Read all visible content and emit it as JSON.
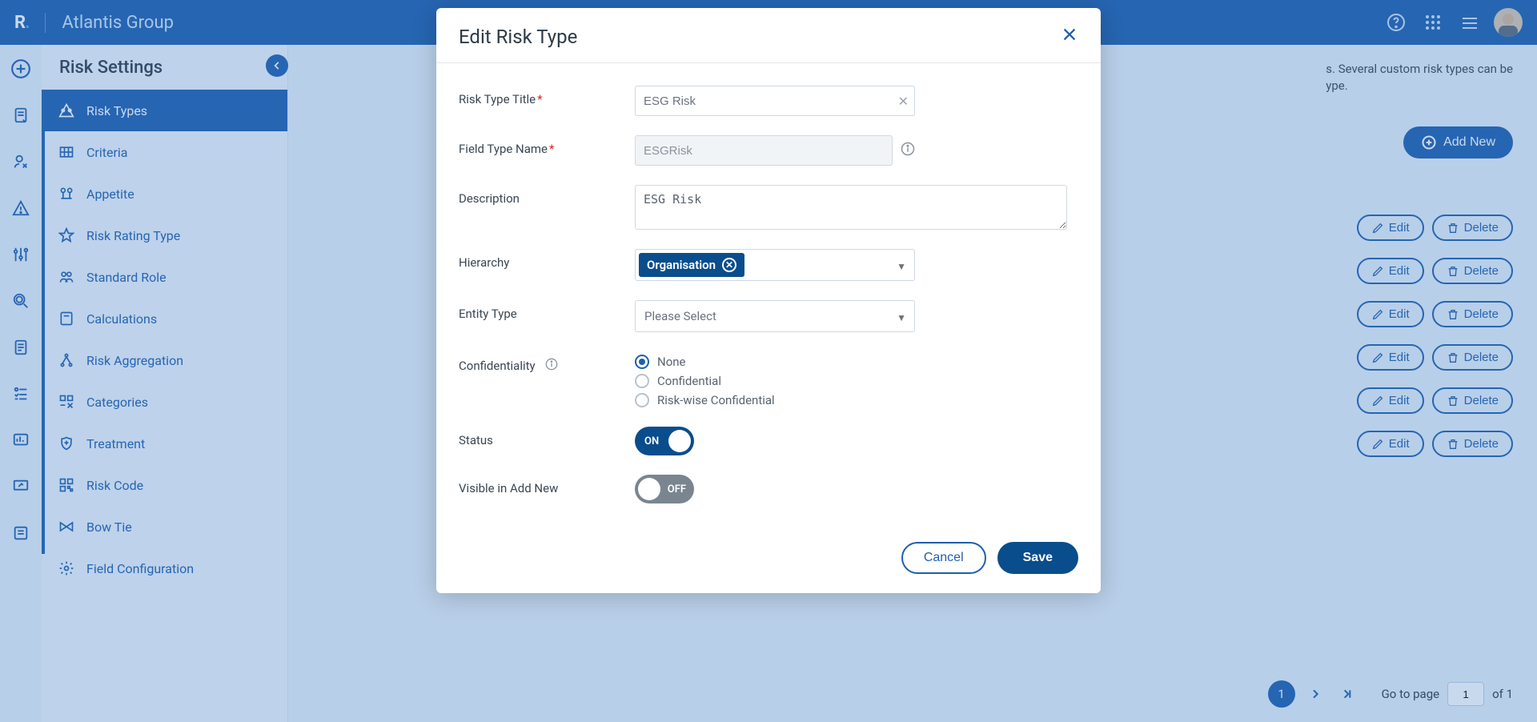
{
  "header": {
    "logo": "R",
    "title": "Atlantis Group"
  },
  "sidebar": {
    "title": "Risk Settings",
    "items": [
      {
        "label": "Risk Types",
        "active": true
      },
      {
        "label": "Criteria"
      },
      {
        "label": "Appetite"
      },
      {
        "label": "Risk Rating Type"
      },
      {
        "label": "Standard Role"
      },
      {
        "label": "Calculations"
      },
      {
        "label": "Risk Aggregation"
      },
      {
        "label": "Categories"
      },
      {
        "label": "Treatment"
      },
      {
        "label": "Risk Code"
      },
      {
        "label": "Bow Tie"
      },
      {
        "label": "Field Configuration"
      }
    ]
  },
  "main": {
    "info_tail1": "s. Several custom risk types can be",
    "info_tail2": "ype.",
    "add_new": "Add New",
    "edit": "Edit",
    "delete": "Delete",
    "pagination": {
      "current": "1",
      "goto_label": "Go to page",
      "input_value": "1",
      "of_label": "of 1"
    }
  },
  "modal": {
    "title": "Edit Risk Type",
    "labels": {
      "risk_type_title": "Risk Type Title",
      "field_type_name": "Field Type Name",
      "description": "Description",
      "hierarchy": "Hierarchy",
      "entity_type": "Entity Type",
      "confidentiality": "Confidentiality",
      "status": "Status",
      "visible_add_new": "Visible in Add New"
    },
    "values": {
      "risk_type_title": "ESG Risk",
      "field_type_name": "ESGRisk",
      "description": "ESG Risk",
      "hierarchy_chip": "Organisation",
      "entity_type_placeholder": "Please Select"
    },
    "confidentiality_options": {
      "none": "None",
      "confidential": "Confidential",
      "riskwise": "Risk-wise Confidential"
    },
    "toggle": {
      "on": "ON",
      "off": "OFF"
    },
    "buttons": {
      "cancel": "Cancel",
      "save": "Save"
    }
  }
}
